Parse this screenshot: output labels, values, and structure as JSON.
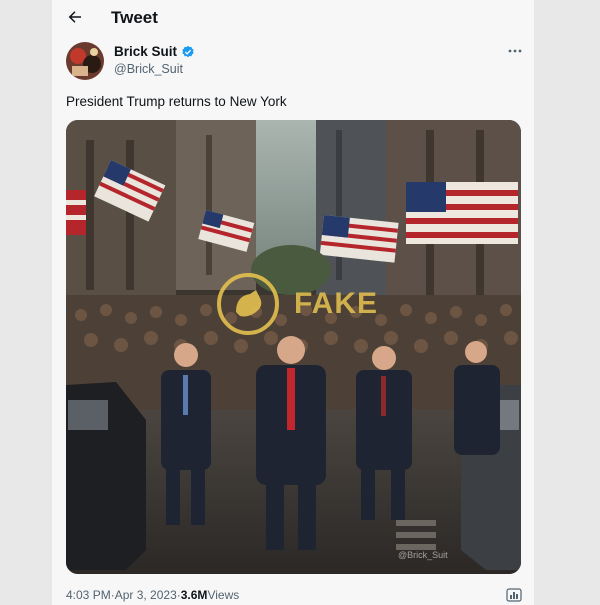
{
  "header": {
    "title": "Tweet"
  },
  "author": {
    "display_name": "Brick Suit",
    "handle": "@Brick_Suit"
  },
  "tweet": {
    "text": "President Trump returns to New York",
    "time": "4:03 PM",
    "separator": " · ",
    "date": "Apr 3, 2023",
    "separator2": " · ",
    "views_count": "3.6M",
    "views_label": " Views"
  },
  "media": {
    "watermark_text": "FAKE",
    "credit": "@Brick_Suit"
  },
  "icons": {
    "back": "arrow-left-icon",
    "verified": "verified-badge-icon",
    "more": "more-horizontal-icon",
    "analytics": "analytics-icon"
  },
  "colors": {
    "accent": "#1d9bf0",
    "watermark": "#e3c04f"
  }
}
